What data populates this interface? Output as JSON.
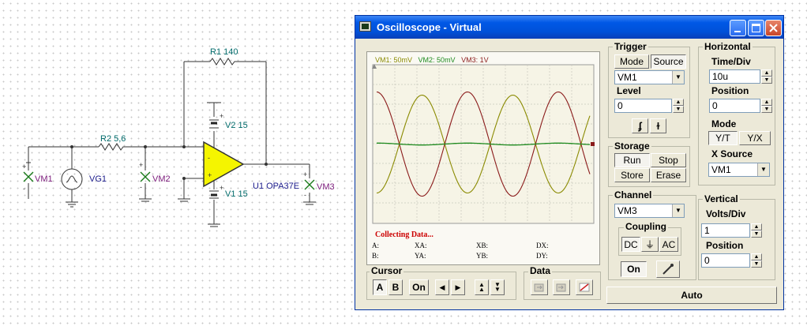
{
  "schematic": {
    "r1": "R1 140",
    "r2": "R2 5,6",
    "v2": "V2 15",
    "v1": "V1 15",
    "u1": "U1 OPA37E",
    "vg1": "VG1",
    "vm1": "VM1",
    "vm2": "VM2",
    "vm3": "VM3"
  },
  "window": {
    "title": "Oscilloscope - Virtual"
  },
  "screen": {
    "legend": [
      {
        "text": "VM1: 50mV",
        "color": "#8a8a00"
      },
      {
        "text": "VM2: 50mV",
        "color": "#1e8a1e"
      },
      {
        "text": "VM3: 1V",
        "color": "#8a1a1a"
      }
    ],
    "status": "Collecting Data...",
    "readouts": {
      "a": "A:",
      "xa": "XA:",
      "xb": "XB:",
      "dx": "DX:",
      "b": "B:",
      "ya": "YA:",
      "yb": "YB:",
      "dy": "DY:"
    }
  },
  "trigger": {
    "title": "Trigger",
    "mode": "Mode",
    "source": "Source",
    "source_value": "VM1",
    "level_label": "Level",
    "level_value": "0"
  },
  "horizontal": {
    "title": "Horizontal",
    "time_div_label": "Time/Div",
    "time_div_value": "10u",
    "position_label": "Position",
    "position_value": "0",
    "mode_label": "Mode",
    "yt": "Y/T",
    "yx": "Y/X",
    "xsource_label": "X Source",
    "xsource_value": "VM1"
  },
  "storage": {
    "title": "Storage",
    "run": "Run",
    "stop": "Stop",
    "store": "Store",
    "erase": "Erase"
  },
  "channel": {
    "title": "Channel",
    "value": "VM3",
    "coupling_title": "Coupling",
    "dc": "DC",
    "gnd": "⏚",
    "ac": "AC",
    "on": "On"
  },
  "vertical": {
    "title": "Vertical",
    "volts_div_label": "Volts/Div",
    "volts_div_value": "1",
    "position_label": "Position",
    "position_value": "0"
  },
  "cursor": {
    "title": "Cursor",
    "a": "A",
    "b": "B",
    "on": "On"
  },
  "data": {
    "title": "Data"
  },
  "auto": "Auto"
}
